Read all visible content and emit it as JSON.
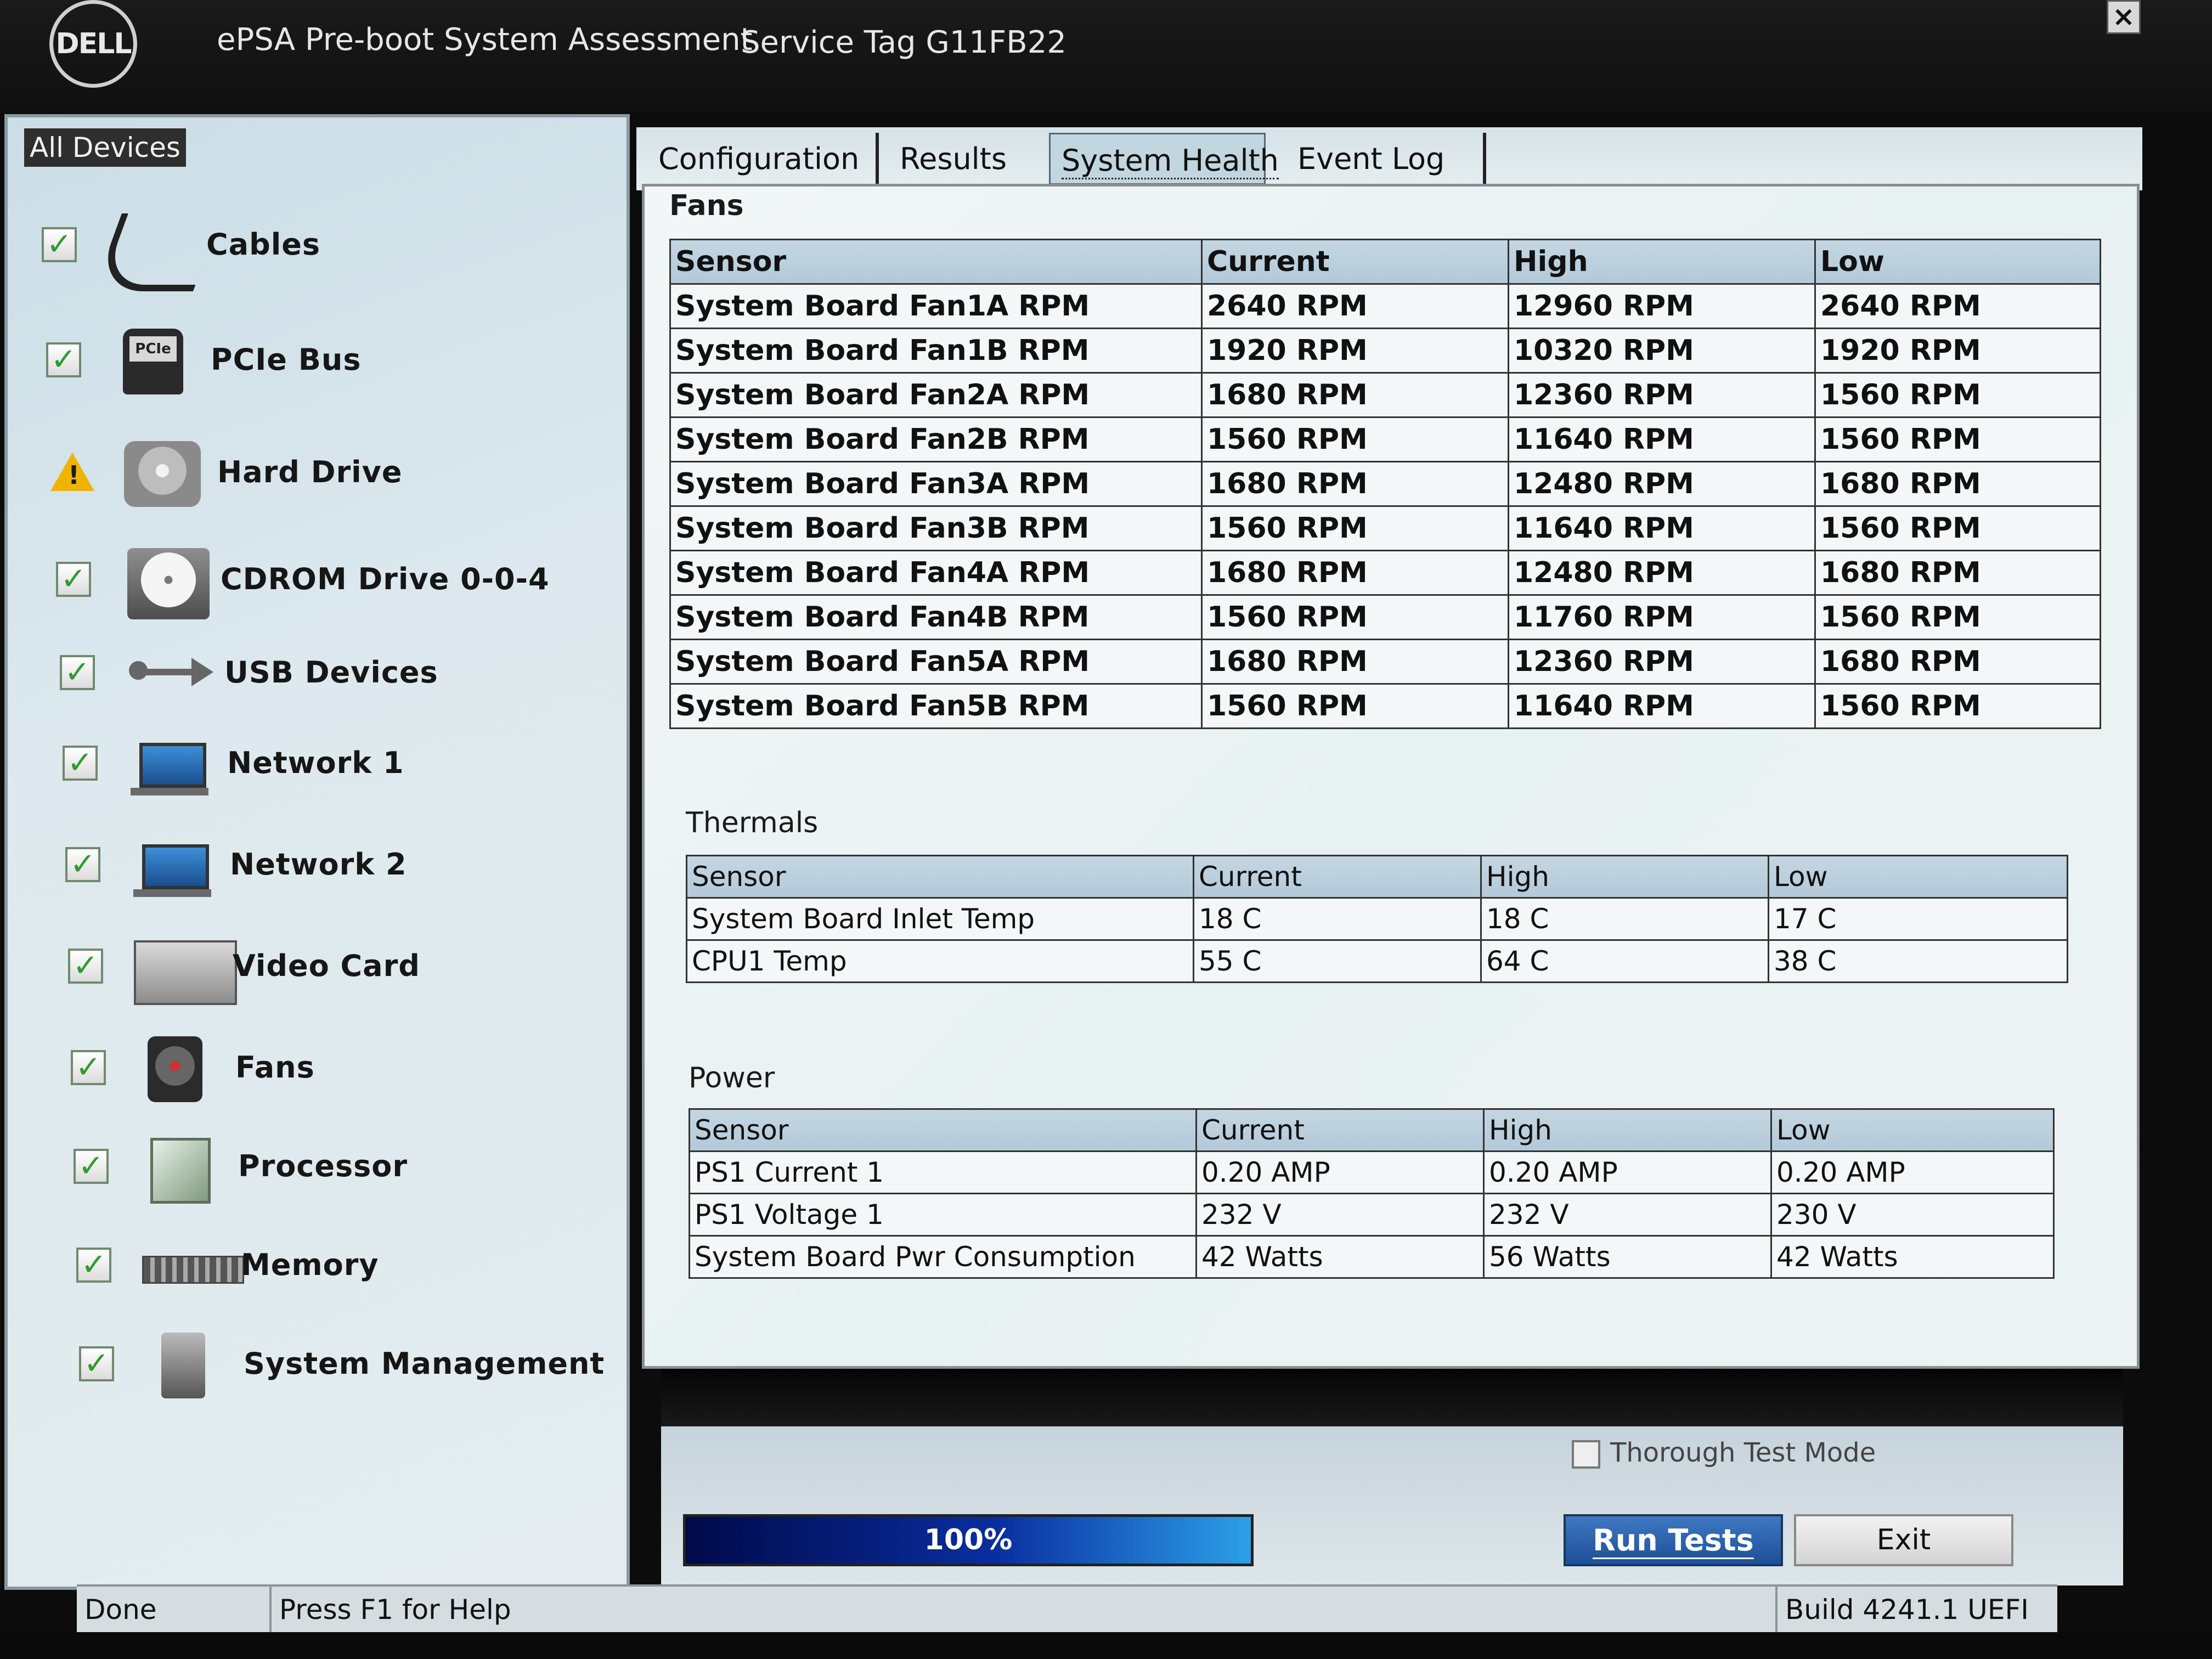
{
  "window": {
    "logo_text": "DELL",
    "app_title": "ePSA Pre-boot System Assessment",
    "service_tag": "Service Tag G11FB22",
    "close_label": "×"
  },
  "devices": {
    "header": "All Devices",
    "items": [
      {
        "label": "Cables",
        "status": "pass",
        "icon": "cable-icon"
      },
      {
        "label": "PCIe Bus",
        "status": "pass",
        "icon": "pcie-bus-icon"
      },
      {
        "label": "Hard Drive",
        "status": "warning",
        "icon": "hard-drive-icon"
      },
      {
        "label": "CDROM Drive 0-0-4",
        "status": "pass",
        "icon": "cdrom-icon"
      },
      {
        "label": "USB Devices",
        "status": "pass",
        "icon": "usb-icon"
      },
      {
        "label": "Network 1",
        "status": "pass",
        "icon": "network-icon"
      },
      {
        "label": "Network 2",
        "status": "pass",
        "icon": "network-icon"
      },
      {
        "label": "Video Card",
        "status": "pass",
        "icon": "video-card-icon"
      },
      {
        "label": "Fans",
        "status": "pass",
        "icon": "fan-icon"
      },
      {
        "label": "Processor",
        "status": "pass",
        "icon": "processor-icon"
      },
      {
        "label": "Memory",
        "status": "pass",
        "icon": "memory-icon"
      },
      {
        "label": "System Management",
        "status": "pass",
        "icon": "system-management-icon"
      }
    ]
  },
  "tabs": [
    {
      "label": "Configuration"
    },
    {
      "label": "Results"
    },
    {
      "label": "System Health",
      "active": true
    },
    {
      "label": "Event Log"
    }
  ],
  "fans": {
    "title": "Fans",
    "columns": [
      "Sensor",
      "Current",
      "High",
      "Low"
    ],
    "rows": [
      [
        "System Board Fan1A RPM",
        "2640 RPM",
        "12960 RPM",
        "2640 RPM"
      ],
      [
        "System Board Fan1B RPM",
        "1920 RPM",
        "10320 RPM",
        "1920 RPM"
      ],
      [
        "System Board Fan2A RPM",
        "1680 RPM",
        "12360 RPM",
        "1560 RPM"
      ],
      [
        "System Board Fan2B RPM",
        "1560 RPM",
        "11640 RPM",
        "1560 RPM"
      ],
      [
        "System Board Fan3A RPM",
        "1680 RPM",
        "12480 RPM",
        "1680 RPM"
      ],
      [
        "System Board Fan3B RPM",
        "1560 RPM",
        "11640 RPM",
        "1560 RPM"
      ],
      [
        "System Board Fan4A RPM",
        "1680 RPM",
        "12480 RPM",
        "1680 RPM"
      ],
      [
        "System Board Fan4B RPM",
        "1560 RPM",
        "11760 RPM",
        "1560 RPM"
      ],
      [
        "System Board Fan5A RPM",
        "1680 RPM",
        "12360 RPM",
        "1680 RPM"
      ],
      [
        "System Board Fan5B RPM",
        "1560 RPM",
        "11640 RPM",
        "1560 RPM"
      ]
    ]
  },
  "thermals": {
    "title": "Thermals",
    "columns": [
      "Sensor",
      "Current",
      "High",
      "Low"
    ],
    "rows": [
      [
        "System Board Inlet Temp",
        "18 C",
        "18 C",
        "17 C"
      ],
      [
        "CPU1 Temp",
        "55 C",
        "64 C",
        "38 C"
      ]
    ]
  },
  "power": {
    "title": "Power",
    "columns": [
      "Sensor",
      "Current",
      "High",
      "Low"
    ],
    "rows": [
      [
        "PS1 Current 1",
        "0.20 AMP",
        "0.20 AMP",
        "0.20 AMP"
      ],
      [
        "PS1 Voltage 1",
        "232 V",
        "232 V",
        "230 V"
      ],
      [
        "System Board Pwr Consumption",
        "42 Watts",
        "56 Watts",
        "42 Watts"
      ]
    ]
  },
  "controls": {
    "thorough_label": "Thorough Test Mode",
    "progress_label": "100%",
    "progress_value": 100,
    "run_tests_label": "Run Tests",
    "exit_label": "Exit"
  },
  "status": {
    "state": "Done",
    "help": "Press F1 for Help",
    "build": "Build  4241.1 UEFI"
  }
}
